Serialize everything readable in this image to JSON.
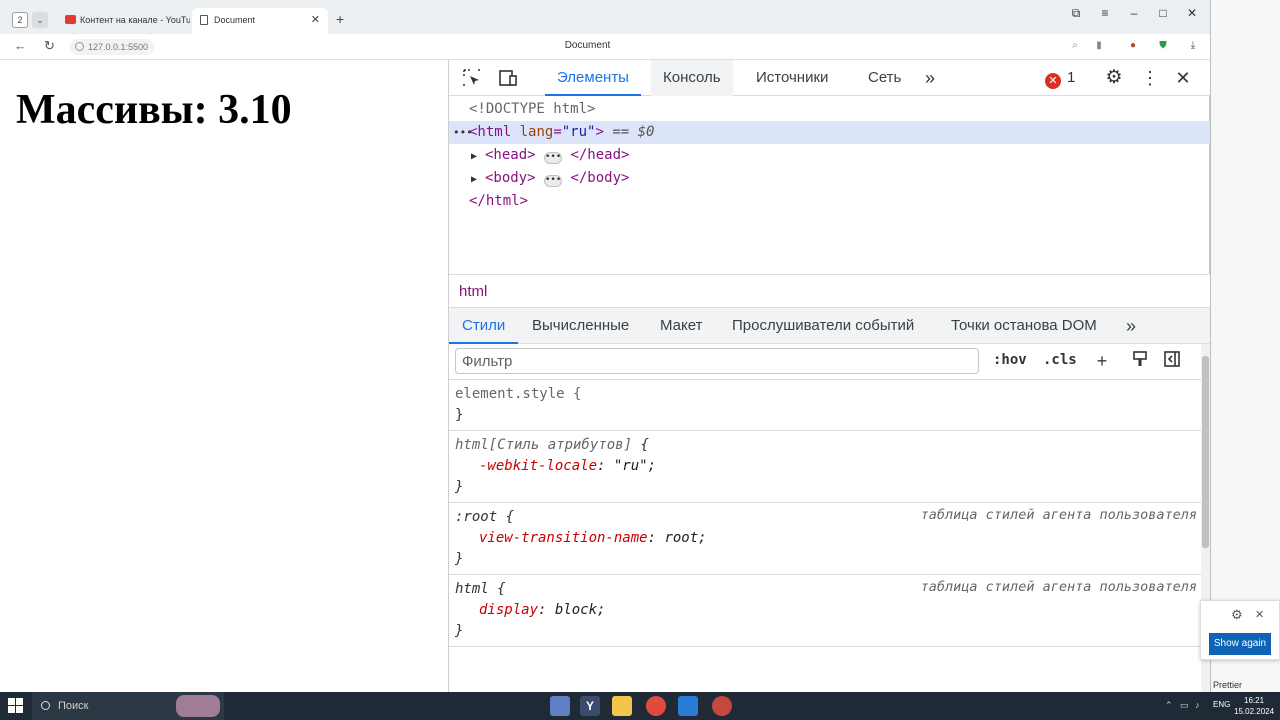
{
  "browser": {
    "tab_count": "2",
    "tabs": [
      {
        "title": "Контент на канале - YouTube"
      },
      {
        "title": "Document"
      }
    ],
    "url": "127.0.0.1:5500",
    "page_title": "Document"
  },
  "page": {
    "heading": "Массивы: 3.10"
  },
  "devtools": {
    "tabs": [
      "Элементы",
      "Консоль",
      "Источники",
      "Сеть"
    ],
    "error_count": "1",
    "dom": {
      "doctype": "<!DOCTYPE html>",
      "html_open_tag": "<html",
      "html_attr_name": "lang",
      "html_attr_value": "\"ru\"",
      "html_close_bracket": ">",
      "eq0": "== $0",
      "head_open": "<head>",
      "head_close": "</head>",
      "body_open": "<body>",
      "body_close": "</body>",
      "html_close": "</html>"
    },
    "breadcrumb": "html",
    "sub_tabs": [
      "Стили",
      "Вычисленные",
      "Макет",
      "Прослушиватели событий",
      "Точки останова DOM"
    ],
    "filter_placeholder": "Фильтр",
    "hov": ":hov",
    "cls": ".cls",
    "rules": [
      {
        "selector": "element.style {",
        "close": "}"
      },
      {
        "selector": "html",
        "selector_extra": "[Стиль атрибутов]",
        "brace": " {",
        "prop": "-webkit-locale",
        "value": "\"ru\";",
        "close": "}"
      },
      {
        "selector": ":root {",
        "origin": "таблица стилей агента пользователя",
        "prop": "view-transition-name",
        "value": "root;",
        "close": "}"
      },
      {
        "selector": "html {",
        "origin": "таблица стилей агента пользователя",
        "prop": "display",
        "value": "block;",
        "close": "}"
      }
    ]
  },
  "side": {
    "show_again": "Show again",
    "prettier": "Prettier"
  },
  "taskbar": {
    "search": "Поиск",
    "lang": "ENG",
    "time": "16:21",
    "date": "15.02.2024"
  },
  "colors": {
    "accent": "#1a73e8",
    "tag": "#881280",
    "error": "#d93025"
  }
}
